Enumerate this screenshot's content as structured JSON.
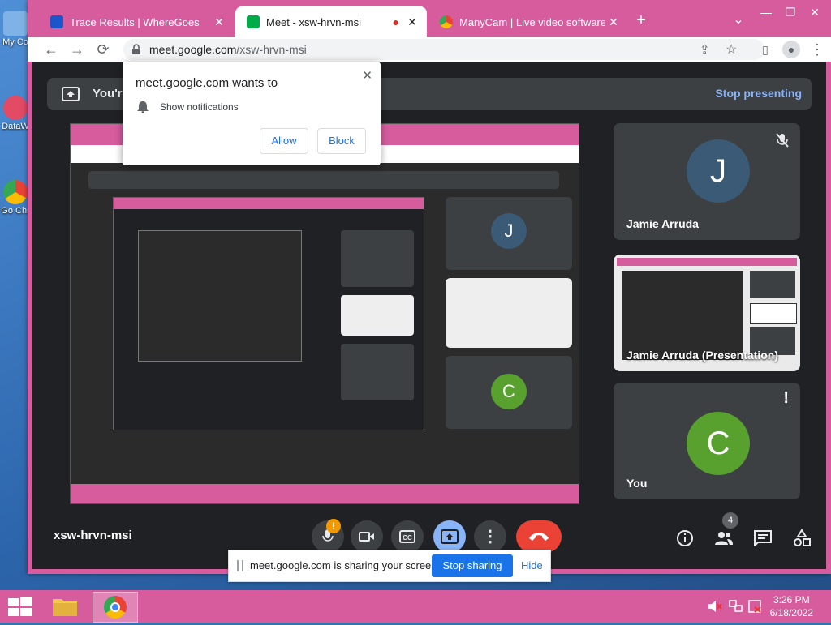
{
  "desktop": {
    "icons": [
      {
        "label": "My Co",
        "color": "#7fb3e8"
      },
      {
        "label": "DataW",
        "color": "#e34a64"
      },
      {
        "label": "Go Chr",
        "color": "#4285f4"
      }
    ]
  },
  "tabs": [
    {
      "title": "Trace Results | WhereGoes",
      "fav_color": "#1a56c9",
      "close": "✕"
    },
    {
      "title": "Meet - xsw-hrvn-msi",
      "fav_color": "#00ac47",
      "recording": "●",
      "close": "✕"
    },
    {
      "title": "ManyCam | Live video software f",
      "fav_color": "#f4b400",
      "close": "✕"
    }
  ],
  "tabstrip": {
    "new_tab": "+",
    "tab_list": "⌄",
    "minimize": "—",
    "restore": "❐",
    "close": "✕"
  },
  "toolbar": {
    "back": "←",
    "forward": "→",
    "reload": "⟳",
    "url_domain": "meet.google.com",
    "url_path": "/xsw-hrvn-msi",
    "share": "⇪",
    "bookmark": "☆",
    "sidebar": "▯",
    "profile": "●",
    "menu": "⋮"
  },
  "presenting": {
    "label": "You're presenting",
    "stop": "Stop presenting"
  },
  "participants": [
    {
      "name": "Jamie Arruda",
      "initial": "J",
      "avatar_color": "#3a5a75",
      "muted": "🎙̸"
    },
    {
      "name": "Jamie Arruda (Presentation)"
    },
    {
      "name": "You",
      "initial": "C",
      "avatar_color": "#59a12f",
      "alert": "!"
    }
  ],
  "meeting": {
    "code": "xsw-hrvn-msi",
    "mic_alert": "!",
    "people_count": "4"
  },
  "share_bar": {
    "text": "meet.google.com is sharing your screen.",
    "stop": "Stop sharing",
    "hide": "Hide"
  },
  "notification_popup": {
    "heading": "meet.google.com wants to",
    "permission": "Show notifications",
    "allow": "Allow",
    "block": "Block",
    "close": "✕"
  },
  "taskbar": {
    "time": "3:26 PM",
    "date": "6/18/2022"
  },
  "colors": {
    "accent": "#d65c9e",
    "meet_bg": "#202124",
    "tile_bg": "#3c4043",
    "end_call": "#ea4335",
    "present_btn": "#8ab4f8"
  }
}
